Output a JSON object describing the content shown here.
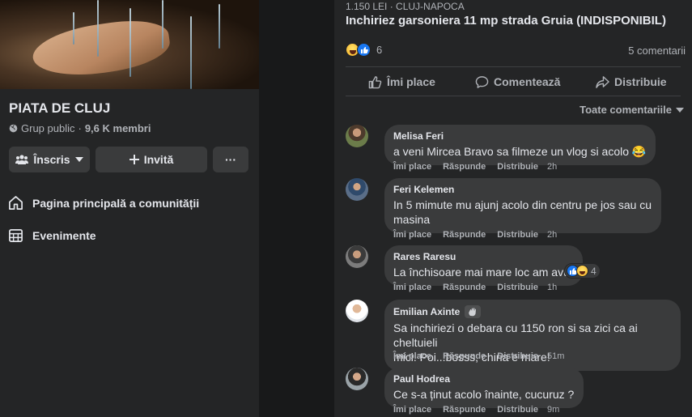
{
  "group": {
    "name": "PIATA DE CLUJ",
    "type": "Grup public",
    "separator": " · ",
    "members": "9,6 K membri",
    "joined_label": "Înscris",
    "invite_label": "Invită",
    "more_label": "···"
  },
  "nav": {
    "home": "Pagina principală a comunității",
    "events": "Evenimente"
  },
  "post": {
    "price_location": "1.150 LEI · CLUJ-NAPOCA",
    "title": "Inchiriez garsoniera 11 mp strada Gruia (INDISPONIBIL)",
    "reactions_count": "6",
    "comments_count": "5 comentarii",
    "actions": {
      "like": "Îmi place",
      "comment": "Comentează",
      "share": "Distribuie"
    },
    "sort_label": "Toate comentariile"
  },
  "comment_actions": {
    "like": "Îmi place",
    "reply": "Răspunde",
    "share": "Distribuie"
  },
  "comments": [
    {
      "author": "Melisa Feri",
      "text": "a veni Mircea Bravo sa filmeze un vlog si acolo 😂",
      "time": "2h"
    },
    {
      "author": "Feri Kelemen",
      "text_line1": "In 5 mimute mu ajunj acolo din centru pe jos sau cu",
      "text_line2": "masina",
      "time": "2h"
    },
    {
      "author": "Rares Raresu",
      "text": "La închisoare mai mare loc am avut",
      "reaction_count": "4",
      "time": "1h"
    },
    {
      "author": "Emilian Axinte",
      "text_line1": "Sa inchiriezi o debara cu 1150 ron si sa zici ca ai cheltuieli",
      "text_line2": "mici. Poi...bosss, chiria e mare!",
      "time": "51m"
    },
    {
      "author": "Paul Hodrea",
      "text": "Ce s-a ținut acolo înainte, cucuruz ?",
      "time": "9m"
    }
  ],
  "colors": {
    "background": "#18191a",
    "panel": "#242526",
    "bubble": "#3a3b3c",
    "primary_text": "#e4e6eb",
    "secondary_text": "#b0b3b8",
    "like_blue": "#1877f2"
  }
}
